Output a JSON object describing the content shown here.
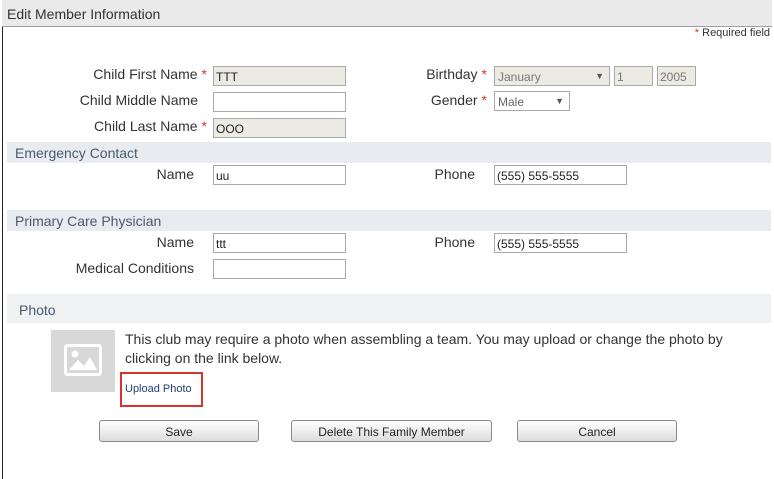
{
  "window": {
    "title": "Edit Member Information"
  },
  "required_note": {
    "star": "*",
    "text": "Required field"
  },
  "child": {
    "first_name_label": "Child First Name",
    "first_name_value": "TTT",
    "middle_name_label": "Child Middle Name",
    "middle_name_value": "",
    "last_name_label": "Child Last Name",
    "last_name_value": "OOO",
    "birthday_label": "Birthday",
    "birthday_month": "January",
    "birthday_day": "1",
    "birthday_year": "2005",
    "gender_label": "Gender",
    "gender_value": "Male",
    "required_star": "*"
  },
  "emergency": {
    "heading": "Emergency Contact",
    "name_label": "Name",
    "name_value": "uu",
    "phone_label": "Phone",
    "phone_value": "(555) 555-5555"
  },
  "physician": {
    "heading": "Primary Care Physician",
    "name_label": "Name",
    "name_value": "ttt",
    "phone_label": "Phone",
    "phone_value": "(555) 555-5555",
    "medical_label": "Medical Conditions",
    "medical_value": ""
  },
  "photo": {
    "heading": "Photo",
    "description": "This club may require a photo when assembling a team. You may upload or change the photo by clicking on the link below.",
    "upload_link": "Upload Photo"
  },
  "buttons": {
    "save": "Save",
    "delete": "Delete This Family Member",
    "cancel": "Cancel"
  },
  "colors": {
    "required_star": "#d9342b",
    "section_band": "#e8ecf0",
    "highlight_box": "#d9342b",
    "link": "#1f3f7a"
  }
}
